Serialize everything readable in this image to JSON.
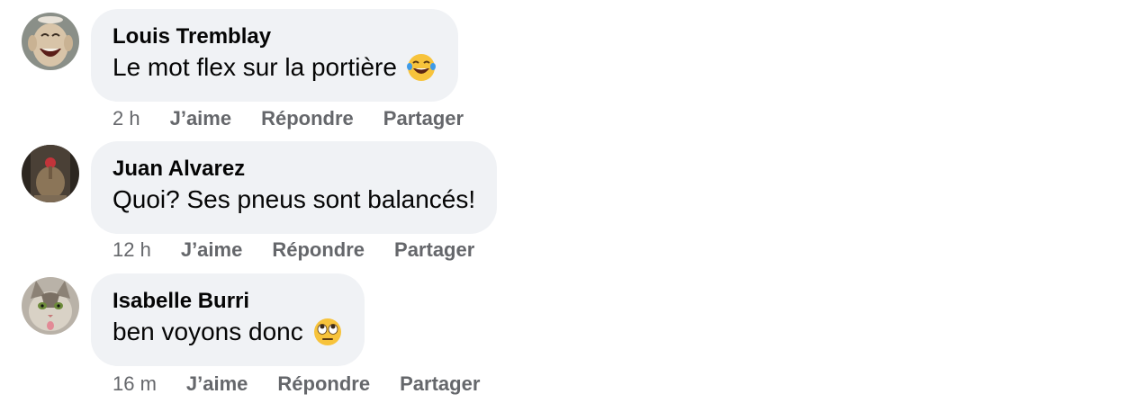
{
  "comments": [
    {
      "author": "Louis Tremblay",
      "text": "Le mot flex sur la portière",
      "emoji": "tears-of-joy-emoji",
      "time": "2 h",
      "like_label": "J’aime",
      "reply_label": "Répondre",
      "share_label": "Partager"
    },
    {
      "author": "Juan Alvarez",
      "text": "Quoi? Ses pneus sont balancés!",
      "time": "12 h",
      "like_label": "J’aime",
      "reply_label": "Répondre",
      "share_label": "Partager"
    },
    {
      "author": "Isabelle Burri",
      "text": "ben voyons donc",
      "emoji": "eye-roll-emoji",
      "time": "16 m",
      "like_label": "J’aime",
      "reply_label": "Répondre",
      "share_label": "Partager"
    }
  ],
  "colors": {
    "bubble": "#f0f2f5",
    "text": "#050505",
    "meta": "#65676b"
  }
}
